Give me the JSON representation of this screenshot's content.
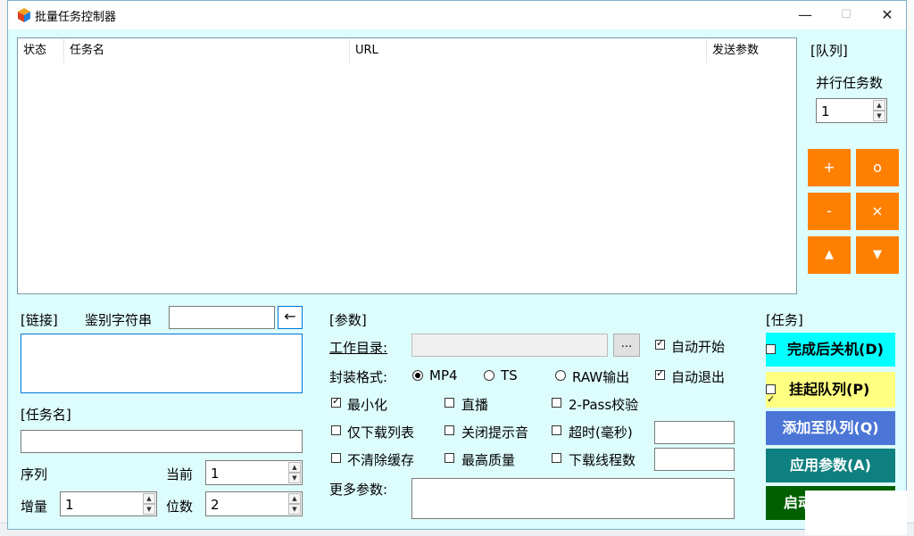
{
  "window": {
    "title": "批量任务控制器",
    "minimize": "—",
    "maximize": "☐",
    "close": "✕"
  },
  "list": {
    "columns": [
      "状态",
      "任务名",
      "URL",
      "发送参数"
    ]
  },
  "queue": {
    "label": "[队列]",
    "parallel_label": "并行任务数",
    "parallel_value": "1",
    "buttons": {
      "add": "+",
      "clear": "o",
      "remove": "-",
      "delete": "×",
      "up": "▲",
      "down": "▼"
    }
  },
  "link": {
    "label": "[链接]",
    "ident_label": "鉴别字符串",
    "ident_value": "",
    "apply_arrow": "←",
    "textarea_value": ""
  },
  "taskname": {
    "label": "[任务名]",
    "value": "",
    "seq_label": "序列",
    "current_label": "当前",
    "current_value": "1",
    "inc_label": "增量",
    "inc_value": "1",
    "digits_label": "位数",
    "digits_value": "2"
  },
  "params": {
    "label": "[参数]",
    "workdir_label": "工作目录:",
    "workdir_value": "",
    "browse": "...",
    "auto_start": "自动开始",
    "auto_exit": "自动退出",
    "format_label": "封装格式:",
    "formats": [
      "MP4",
      "TS",
      "RAW输出"
    ],
    "minimize": "最小化",
    "live": "直播",
    "two_pass": "2-Pass校验",
    "list_only": "仅下载列表",
    "close_sound": "关闭提示音",
    "timeout": "超时(毫秒)",
    "timeout_value": "",
    "no_clear_cache": "不清除缓存",
    "best_quality": "最高质量",
    "threads": "下载线程数",
    "threads_value": "",
    "more_label": "更多参数:",
    "more_value": ""
  },
  "task": {
    "label": "[任务]",
    "shutdown": "完成后关机(D)",
    "suspend": "挂起队列(P)",
    "add_queue": "添加至队列(Q)",
    "apply": "应用参数(A)",
    "start": "启动"
  },
  "colors": {
    "window_bg": "#ddfcfc",
    "orange": "#ff8000",
    "cyan": "#00ffff",
    "yellow": "#ffff80",
    "blue": "#4b76d7",
    "teal": "#0f8080",
    "green": "#006000"
  }
}
